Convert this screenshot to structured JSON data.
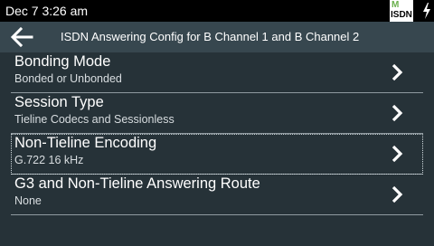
{
  "statusbar": {
    "time": "Dec 7 3:26 am",
    "badge_top": "M",
    "badge_bottom": "ISDN",
    "icons": [
      "isdn-status-icon",
      "lightning-bolt-icon"
    ]
  },
  "header": {
    "back_icon": "back-arrow-icon",
    "title": "ISDN Answering Config for B Channel 1 and B Channel 2"
  },
  "items": [
    {
      "label": "Bonding Mode",
      "value": "Bonded or Unbonded"
    },
    {
      "label": "Session Type",
      "value": "Tieline Codecs and Sessionless"
    },
    {
      "label": "Non-Tieline Encoding",
      "value": "G.722 16 kHz",
      "focused": true
    },
    {
      "label": "G3 and Non-Tieline Answering Route",
      "value": "None"
    }
  ],
  "colors": {
    "background": "#263238",
    "header": "#37474f",
    "statusbar": "#000000",
    "badge_accent": "#6ab04c"
  }
}
